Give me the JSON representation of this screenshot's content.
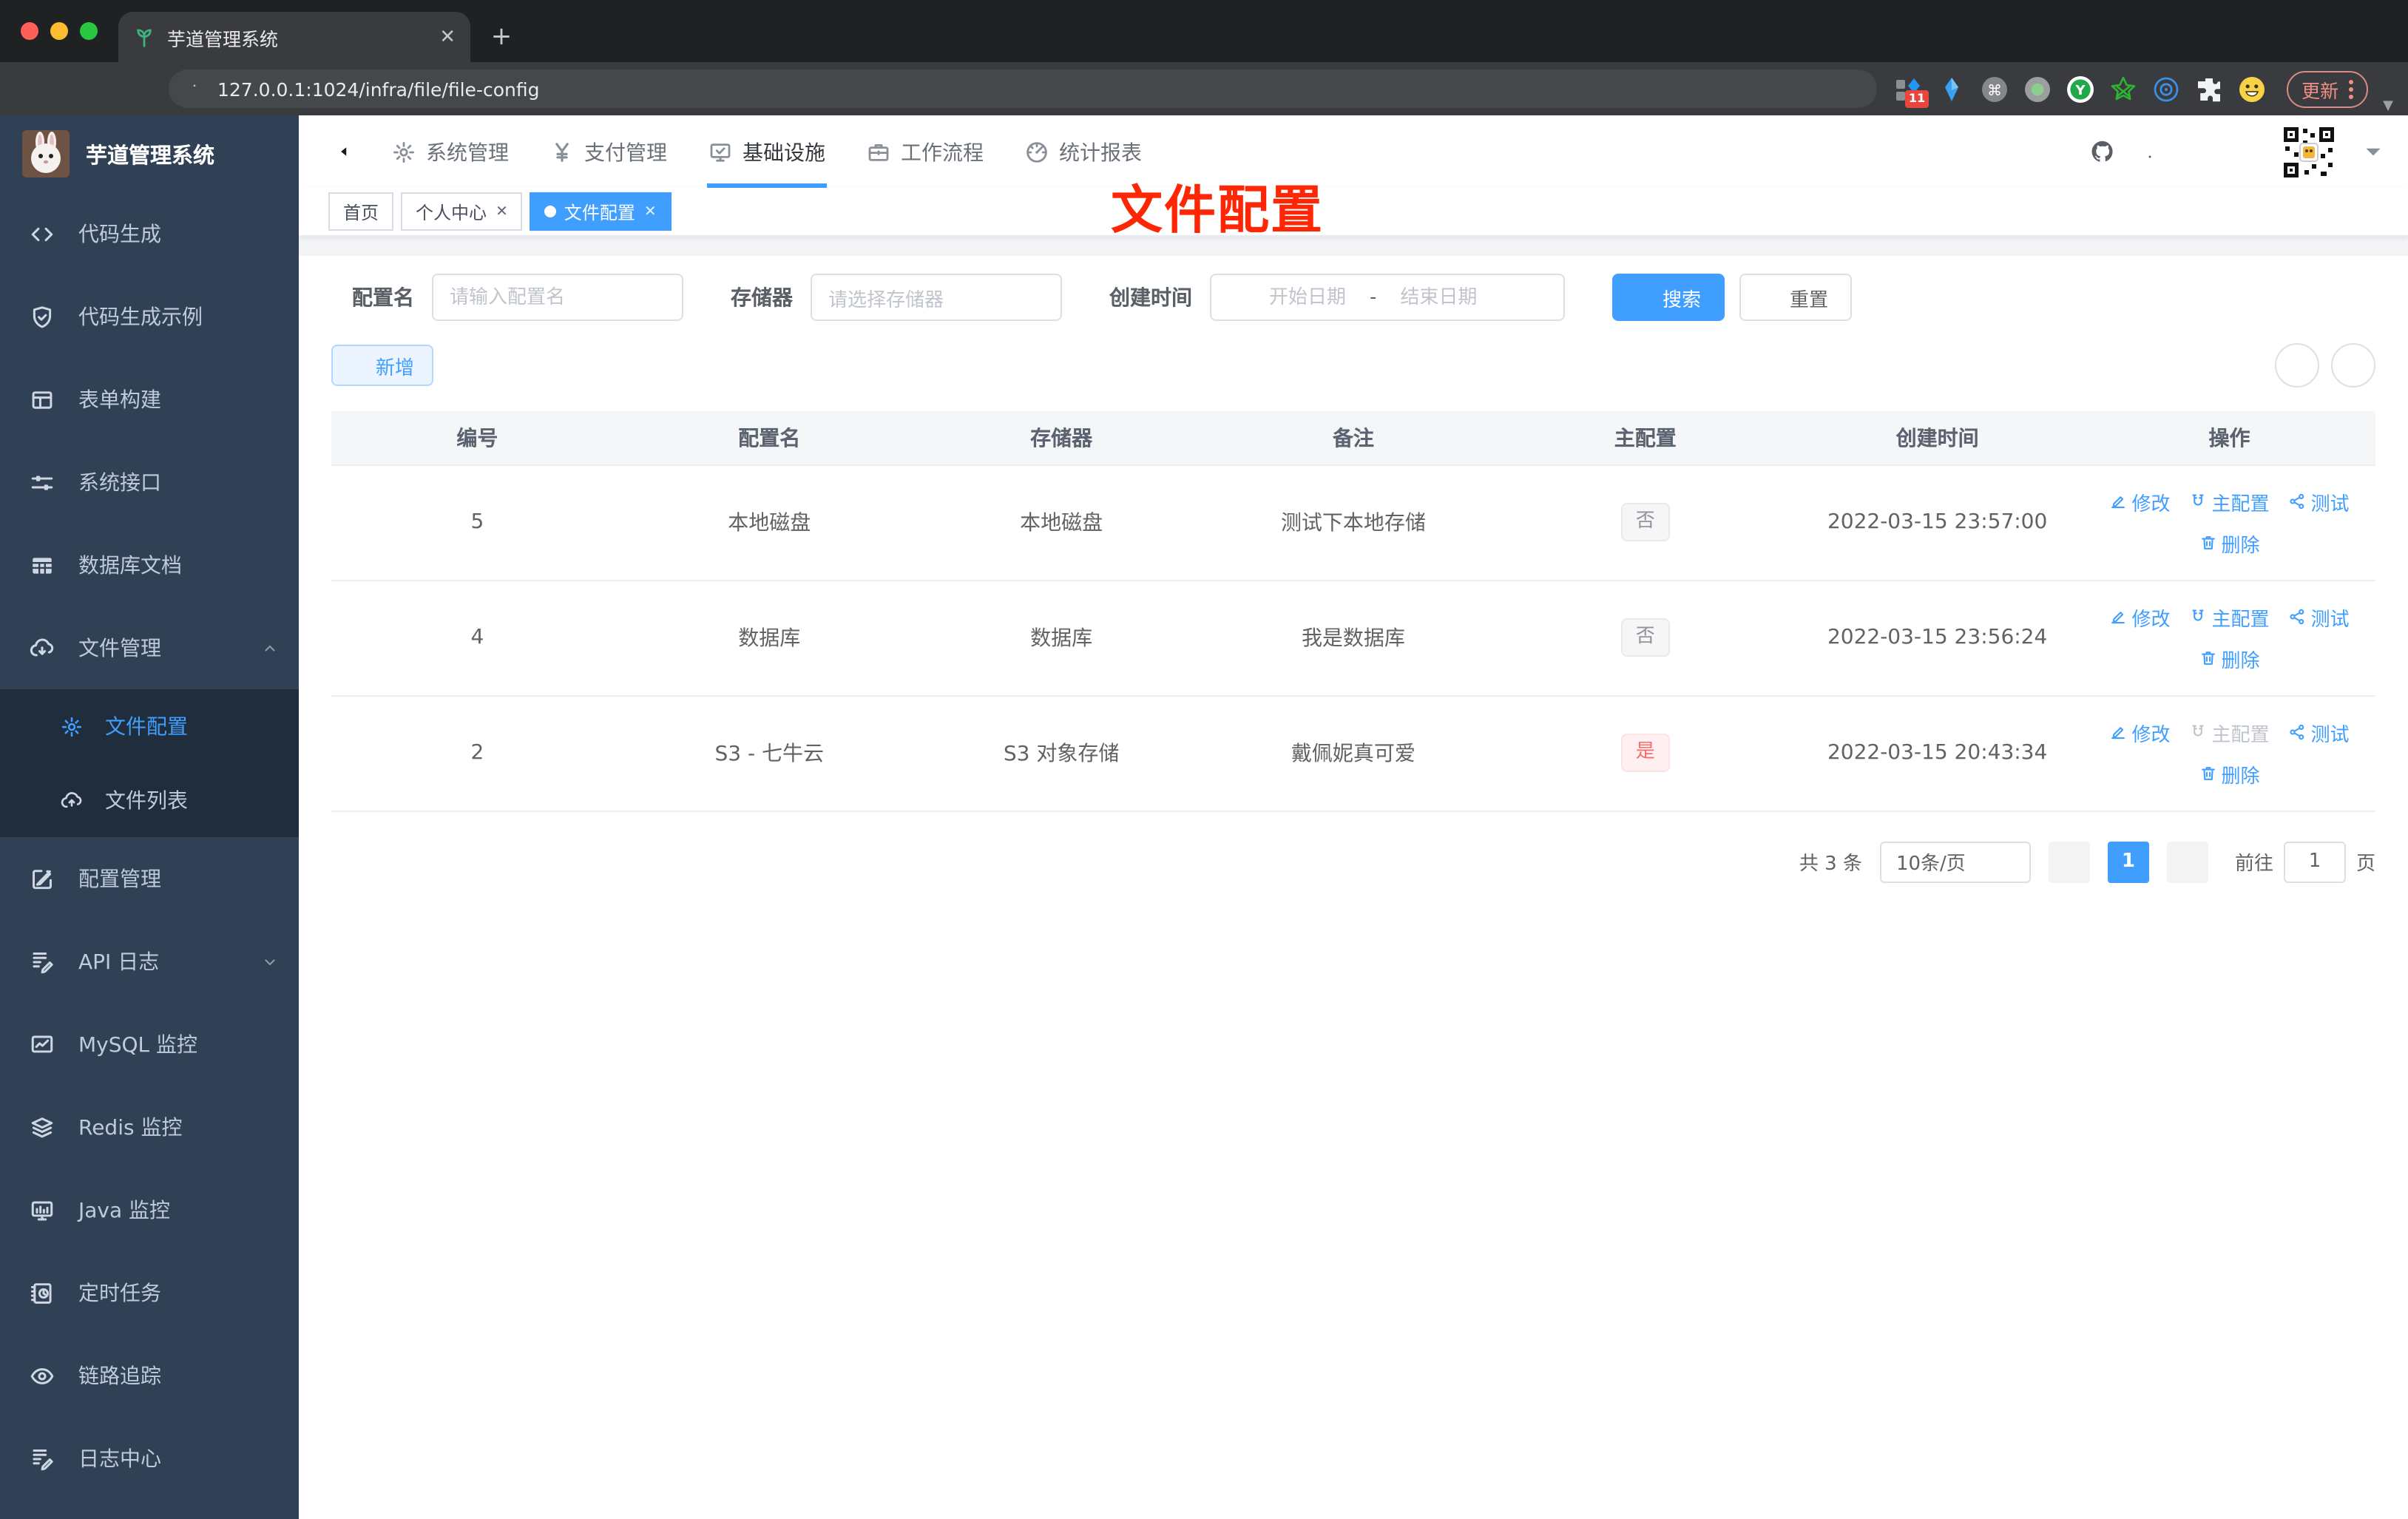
{
  "browser": {
    "tab_title": "芋道管理系统",
    "url": "127.0.0.1:1024/infra/file/file-config",
    "update_label": "更新",
    "extensions_badge": "11"
  },
  "sidebar": {
    "app_title": "芋道管理系统",
    "items": [
      {
        "label": "代码生成",
        "icon": "code"
      },
      {
        "label": "代码生成示例",
        "icon": "shield-check"
      },
      {
        "label": "表单构建",
        "icon": "form"
      },
      {
        "label": "系统接口",
        "icon": "sliders"
      },
      {
        "label": "数据库文档",
        "icon": "db-grid"
      },
      {
        "label": "文件管理",
        "icon": "cloud-download",
        "chevron": "up",
        "children": [
          {
            "label": "文件配置",
            "icon": "gear",
            "active": true
          },
          {
            "label": "文件列表",
            "icon": "cloud-upload"
          }
        ]
      },
      {
        "label": "配置管理",
        "icon": "edit-square"
      },
      {
        "label": "API 日志",
        "icon": "log-edit",
        "chevron": "down"
      },
      {
        "label": "MySQL 监控",
        "icon": "chart-monitor"
      },
      {
        "label": "Redis 监控",
        "icon": "layers"
      },
      {
        "label": "Java 监控",
        "icon": "monitor-bars"
      },
      {
        "label": "定时任务",
        "icon": "notebook-clock"
      },
      {
        "label": "链路追踪",
        "icon": "eye"
      },
      {
        "label": "日志中心",
        "icon": "log-edit"
      }
    ]
  },
  "header": {
    "nav": [
      {
        "label": "系统管理",
        "icon": "gear"
      },
      {
        "label": "支付管理",
        "icon": "yen"
      },
      {
        "label": "基础设施",
        "icon": "monitor-check",
        "active": true
      },
      {
        "label": "工作流程",
        "icon": "briefcase"
      },
      {
        "label": "统计报表",
        "icon": "dashboard"
      }
    ]
  },
  "tags": [
    {
      "label": "首页"
    },
    {
      "label": "个人中心",
      "closable": true
    },
    {
      "label": "文件配置",
      "closable": true,
      "active": true
    }
  ],
  "overlay_title": "文件配置",
  "filters": {
    "name_label": "配置名",
    "name_placeholder": "请输入配置名",
    "storage_label": "存储器",
    "storage_placeholder": "请选择存储器",
    "date_label": "创建时间",
    "date_start": "开始日期",
    "date_sep": "-",
    "date_end": "结束日期",
    "search_label": "搜索",
    "reset_label": "重置"
  },
  "toolbar": {
    "add_label": "新增"
  },
  "table": {
    "columns": [
      "编号",
      "配置名",
      "存储器",
      "备注",
      "主配置",
      "创建时间",
      "操作"
    ],
    "ops": {
      "edit": "修改",
      "master": "主配置",
      "test": "测试",
      "delete": "删除"
    },
    "rows": [
      {
        "id": "5",
        "name": "本地磁盘",
        "storage": "本地磁盘",
        "remark": "测试下本地存储",
        "master": "否",
        "master_type": "info",
        "master_disabled": false,
        "created": "2022-03-15 23:57:00"
      },
      {
        "id": "4",
        "name": "数据库",
        "storage": "数据库",
        "remark": "我是数据库",
        "master": "否",
        "master_type": "info",
        "master_disabled": false,
        "created": "2022-03-15 23:56:24"
      },
      {
        "id": "2",
        "name": "S3 - 七牛云",
        "storage": "S3 对象存储",
        "remark": "戴佩妮真可爱",
        "master": "是",
        "master_type": "danger",
        "master_disabled": true,
        "created": "2022-03-15 20:43:34"
      }
    ]
  },
  "pagination": {
    "total": "共 3 条",
    "page_size": "10条/页",
    "current": "1",
    "goto_label": "前往",
    "goto_value": "1",
    "page_unit": "页"
  },
  "colors": {
    "primary": "#409eff",
    "danger": "#f56c6c",
    "sidebar_bg": "#304156",
    "overlay_red": "#ff2605"
  }
}
